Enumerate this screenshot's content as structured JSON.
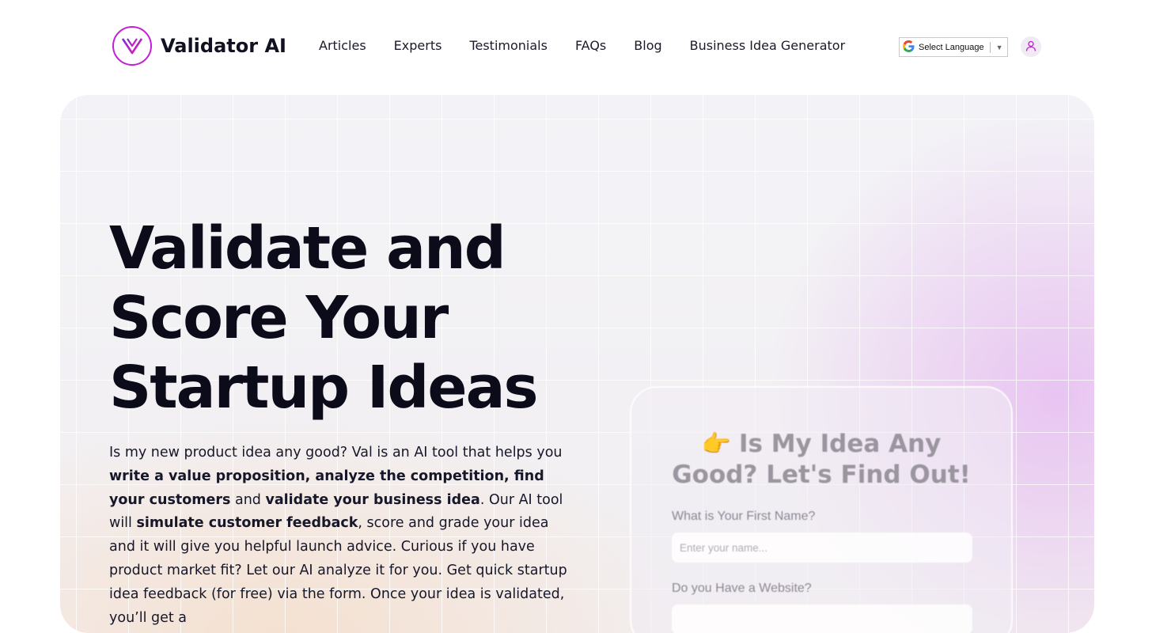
{
  "brand": {
    "name": "Validator AI",
    "logo_icon": "v-logo-icon",
    "accent": "#c21fd6"
  },
  "nav": {
    "items": [
      {
        "label": "Articles"
      },
      {
        "label": "Experts"
      },
      {
        "label": "Testimonials"
      },
      {
        "label": "FAQs"
      },
      {
        "label": "Blog"
      },
      {
        "label": "Business Idea Generator"
      }
    ]
  },
  "language_selector": {
    "label": "Select Language",
    "icon": "google-g-icon"
  },
  "user": {
    "icon": "user-icon"
  },
  "hero": {
    "title_lines": [
      "Validate and",
      "Score Your",
      "Startup Ideas"
    ],
    "description": {
      "p1": "Is my new product idea any good?   Val is an AI tool that helps you ",
      "b1": "write a value proposition, analyze the competition, find your customers",
      "p2": " and ",
      "b2": "validate your business idea",
      "p3": ".  Our AI tool will ",
      "b3": "simulate customer feedback",
      "p4": ", score and grade your idea and it will give you helpful launch advice.  Curious if you have product market fit?  Let our AI analyze it for you.  Get quick startup idea feedback (for free) via the form.  Once your idea is validated, you’ll get a"
    }
  },
  "form": {
    "emoji": "👉",
    "title_line1": "Is My Idea Any",
    "title_line2": "Good?  Let's Find Out!",
    "name_label": "What is Your First Name?",
    "name_placeholder": "Enter your name...",
    "website_label": "Do you Have a Website?"
  }
}
